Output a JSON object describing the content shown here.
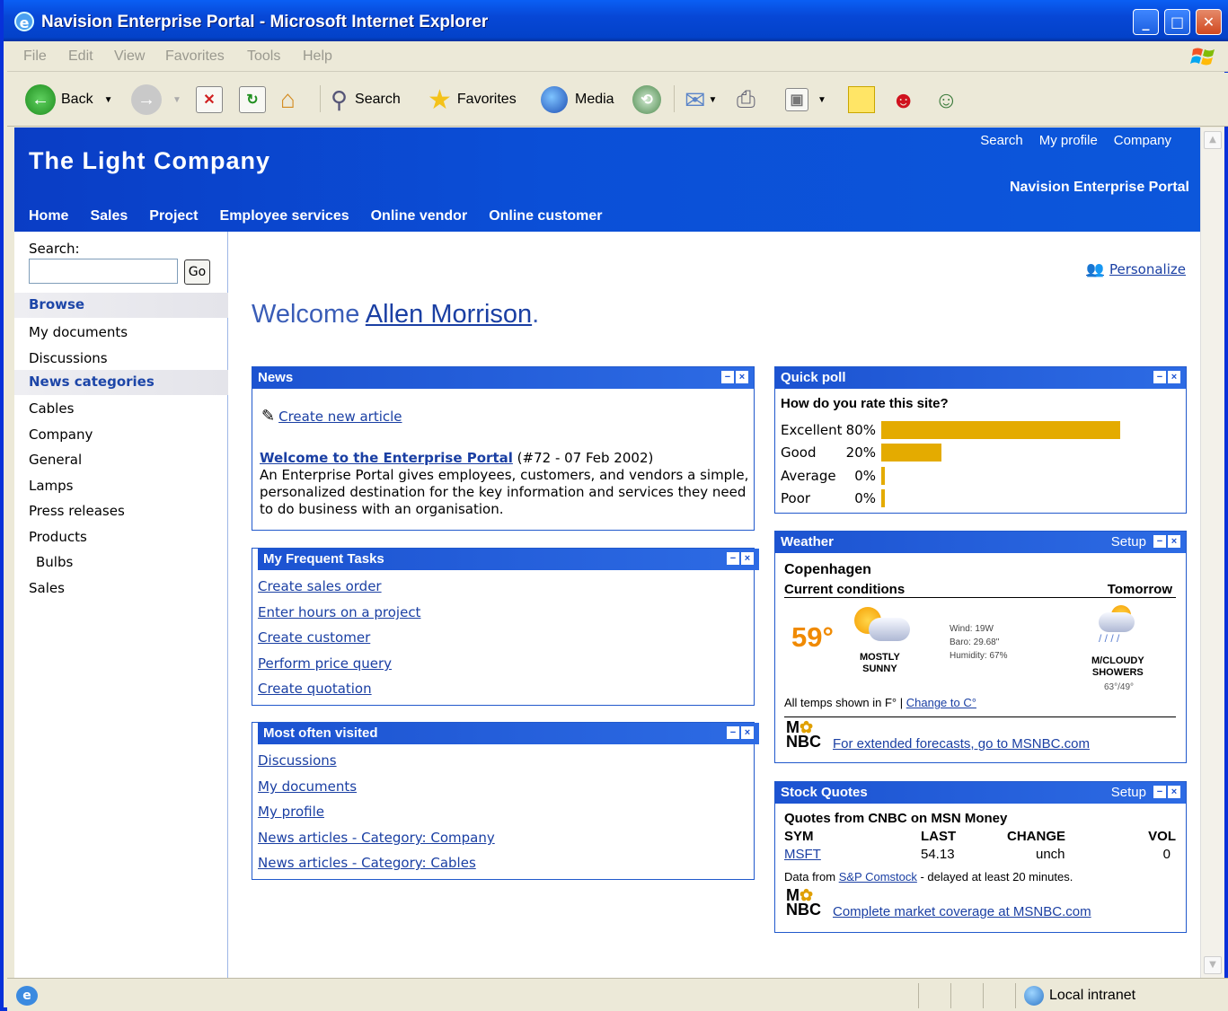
{
  "window": {
    "title": "Navision Enterprise Portal - Microsoft Internet Explorer",
    "controls": [
      "minimize",
      "maximize",
      "close"
    ]
  },
  "menu": [
    "File",
    "Edit",
    "View",
    "Favorites",
    "Tools",
    "Help"
  ],
  "toolbar": {
    "back": "Back",
    "search": "Search",
    "favorites": "Favorites",
    "media": "Media"
  },
  "header": {
    "brand": "The Light Company",
    "top_links": [
      "Search",
      "My profile",
      "Company"
    ],
    "portal": "Navision Enterprise Portal",
    "nav": [
      "Home",
      "Sales",
      "Project",
      "Employee services",
      "Online vendor",
      "Online customer"
    ]
  },
  "sidebar": {
    "search_label": "Search:",
    "search_value": "",
    "go": "Go",
    "browse_title": "Browse",
    "browse_items": [
      "My documents",
      "Discussions"
    ],
    "categories_title": "News categories",
    "categories": [
      "Cables",
      "Company",
      "General",
      "Lamps",
      "Press releases",
      "Products",
      "Bulbs",
      "Sales"
    ]
  },
  "main": {
    "personalize": "Personalize",
    "welcome_prefix": "Welcome ",
    "user_name": "Allen Morrison",
    "welcome_suffix": "."
  },
  "news": {
    "title": "News",
    "create": "Create new article",
    "headline": "Welcome to the Enterprise Portal",
    "meta": "(#72 - 07 Feb 2002)",
    "body": "An Enterprise Portal gives employees, customers, and vendors a simple, personalized destination for the key information and services they need to do business with an organisation."
  },
  "tasks": {
    "title": "My Frequent Tasks",
    "items": [
      "Create sales order",
      "Enter hours on a project",
      "Create customer",
      "Perform price query",
      "Create quotation"
    ]
  },
  "visited": {
    "title": "Most often visited",
    "items": [
      "Discussions",
      "My documents",
      "My profile",
      "News articles - Category: Company",
      "News articles - Category: Cables"
    ]
  },
  "poll": {
    "title": "Quick poll",
    "question": "How do you rate this site?",
    "options": [
      {
        "name": "Excellent",
        "percent": "80%",
        "value": 0.8
      },
      {
        "name": "Good",
        "percent": "20%",
        "value": 0.2
      },
      {
        "name": "Average",
        "percent": "0%",
        "value": 0
      },
      {
        "name": "Poor",
        "percent": "0%",
        "value": 0
      }
    ],
    "bar_color": "#e4ab00"
  },
  "weather": {
    "title": "Weather",
    "setup": "Setup",
    "city": "Copenhagen",
    "current_label": "Current conditions",
    "tomorrow_label": "Tomorrow",
    "temp": "59°",
    "condition_1": "MOSTLY",
    "condition_2": "SUNNY",
    "wind": "Wind: 19W",
    "baro": "Baro: 29.68\"",
    "humidity": "Humidity: 67%",
    "tomorrow_1": "M/CLOUDY",
    "tomorrow_2": "SHOWERS",
    "tomorrow_temps": "63°/49°",
    "units_note": "All temps shown in F° | ",
    "change_link": "Change to C°",
    "msnbc_link": "For extended forecasts, go to MSNBC.com"
  },
  "stocks": {
    "title": "Stock Quotes",
    "setup": "Setup",
    "source": "Quotes from CNBC on MSN Money",
    "headers": [
      "SYM",
      "LAST",
      "CHANGE",
      "VOL"
    ],
    "row": {
      "sym": "MSFT",
      "last": "54.13",
      "change": "unch",
      "vol": "0"
    },
    "data_from": "Data from ",
    "comstock": "S&P Comstock",
    "delay": " - delayed at least 20 minutes.",
    "msnbc_link": "Complete market coverage at MSNBC.com"
  },
  "status": {
    "zone": "Local intranet"
  }
}
